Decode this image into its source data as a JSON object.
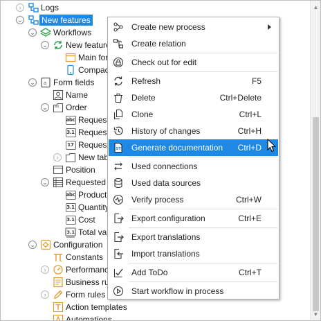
{
  "tree": {
    "items": [
      {
        "label": "Logs"
      },
      {
        "label": "New features"
      },
      {
        "label": "Workflows"
      },
      {
        "label": "New feature"
      },
      {
        "label": "Main form"
      },
      {
        "label": "Compact"
      },
      {
        "label": "Form fields"
      },
      {
        "label": "Name"
      },
      {
        "label": "Order"
      },
      {
        "label": "Requeste"
      },
      {
        "label": "Request"
      },
      {
        "label": "Request"
      },
      {
        "label": "New tab"
      },
      {
        "label": "Position"
      },
      {
        "label": "Requested p"
      },
      {
        "label": "Product r"
      },
      {
        "label": "Quantity"
      },
      {
        "label": "Cost"
      },
      {
        "label": "Total valu"
      },
      {
        "label": "Configuration"
      },
      {
        "label": "Constants"
      },
      {
        "label": "Performance"
      },
      {
        "label": "Business rule"
      },
      {
        "label": "Form rules"
      },
      {
        "label": "Action templates"
      },
      {
        "label": "Automations"
      }
    ],
    "badges": {
      "abc": "abc",
      "num": "3.1",
      "date": "17",
      "ab": "ab"
    }
  },
  "context_menu": {
    "items": [
      {
        "label": "Create new process",
        "shortcut": "",
        "icon": "create-process-icon",
        "submenu": true
      },
      {
        "label": "Create relation",
        "shortcut": "",
        "icon": "relation-icon"
      },
      {
        "label": "Check out for edit",
        "shortcut": "",
        "icon": "lock-icon"
      },
      {
        "label": "Refresh",
        "shortcut": "F5",
        "icon": "refresh-icon"
      },
      {
        "label": "Delete",
        "shortcut": "Ctrl+Delete",
        "icon": "delete-icon"
      },
      {
        "label": "Clone",
        "shortcut": "Ctrl+L",
        "icon": "clone-icon"
      },
      {
        "label": "History of changes",
        "shortcut": "Ctrl+H",
        "icon": "history-icon"
      },
      {
        "label": "Generate documentation",
        "shortcut": "Ctrl+D",
        "icon": "documentation-icon",
        "highlighted": true
      },
      {
        "label": "Used connections",
        "shortcut": "",
        "icon": "connections-icon"
      },
      {
        "label": "Used data sources",
        "shortcut": "",
        "icon": "data-sources-icon"
      },
      {
        "label": "Verify process",
        "shortcut": "Ctrl+W",
        "icon": "verify-icon"
      },
      {
        "label": "Export configuration",
        "shortcut": "Ctrl+E",
        "icon": "export-icon"
      },
      {
        "label": "Export translations",
        "shortcut": "",
        "icon": "export-translations-icon"
      },
      {
        "label": "Import translations",
        "shortcut": "",
        "icon": "import-translations-icon"
      },
      {
        "label": "Add ToDo",
        "shortcut": "Ctrl+T",
        "icon": "todo-icon"
      },
      {
        "label": "Start workflow in process",
        "shortcut": "",
        "icon": "start-workflow-icon"
      }
    ]
  },
  "colors": {
    "accent": "#1e88e5",
    "icon_blue": "#1e88e5",
    "icon_orange": "#e39b2b",
    "icon_green": "#2e9e4b"
  }
}
